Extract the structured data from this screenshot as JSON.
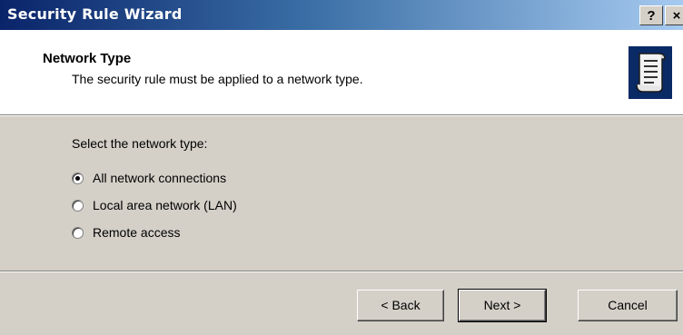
{
  "window": {
    "title": "Security Rule Wizard",
    "help_label": "?",
    "close_label": "×"
  },
  "header": {
    "title": "Network Type",
    "subtitle": "The security rule must be applied to a network type."
  },
  "main": {
    "prompt": "Select the network type:",
    "options": [
      {
        "label": "All network connections",
        "checked": true
      },
      {
        "label": "Local area network (LAN)",
        "checked": false
      },
      {
        "label": "Remote access",
        "checked": false
      }
    ]
  },
  "footer": {
    "back_label": "< Back",
    "next_label": "Next >",
    "cancel_label": "Cancel"
  },
  "icons": {
    "header_icon": "scroll-document-icon"
  },
  "colors": {
    "titlebar_start": "#0a246a",
    "titlebar_end": "#a6caf0",
    "dialog_face": "#d4d0c8",
    "header_bg": "#ffffff",
    "header_icon_bg": "#0a2a66"
  }
}
